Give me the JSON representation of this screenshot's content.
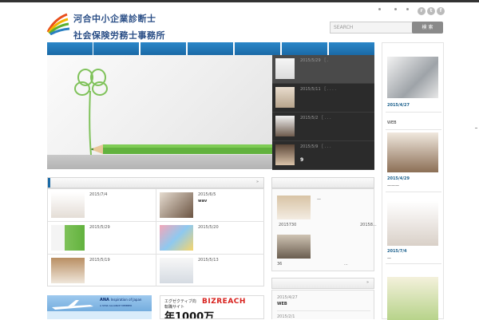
{
  "header": {
    "logo_line1": "河合中小企業診断士",
    "logo_line2": "社会保険労務士事務所",
    "search_placeholder": "SEARCH",
    "search_button": "検 索"
  },
  "social_icons": [
    "rss-icon",
    "twitter-icon",
    "facebook-icon"
  ],
  "colors": {
    "nav": "#1b6aa6",
    "logo_text": "#2a4e86",
    "slider_bg": "#2b2b2b"
  },
  "slider": {
    "items": [
      {
        "date": "2015/5/29 ［ .",
        "title": ""
      },
      {
        "date": "2015/5/11 ［ . . . .",
        "title": ""
      },
      {
        "date": "2015/5/2 ［ .      . .",
        "title": ""
      },
      {
        "date": "2015/5/9 ［    . .  .",
        "title": "9"
      }
    ]
  },
  "posts_bar": {
    "arrow": "»"
  },
  "posts": [
    {
      "date": "2015/7/4",
      "title": ""
    },
    {
      "date": "2015/6/5",
      "title": "wav"
    },
    {
      "date": "2015/5/29",
      "title": ""
    },
    {
      "date": "2015/5/20",
      "title": ""
    },
    {
      "date": "2015/5/19",
      "title": ""
    },
    {
      "date": "2015/5/13",
      "title": ""
    }
  ],
  "middle": {
    "item1_text": "—",
    "item1_left": "2015730",
    "item1_right": "20158...",
    "item2_left": "36",
    "item2_right": "...",
    "bar_arrow": "»",
    "list": [
      {
        "date": "2015/4/27",
        "title": "WEB"
      },
      {
        "date": "2015/2/1",
        "title": ""
      }
    ]
  },
  "sidebar": {
    "items": [
      {
        "date": "2015/4/27",
        "title": "WEB"
      },
      {
        "date": "2015/4/29",
        "title": "———"
      },
      {
        "date": "2015/7/4",
        "title": "—"
      }
    ]
  },
  "banners": {
    "ana_logo": "ANA",
    "ana_text": "Inspiration of Japan",
    "ana_sub": "A STAR ALLIANCE MEMBER",
    "biz_small1": "エグゼクティブ向",
    "biz_small2": "転職サイト",
    "biz_logo": "BIZREACH",
    "biz_big": "年1000万"
  }
}
